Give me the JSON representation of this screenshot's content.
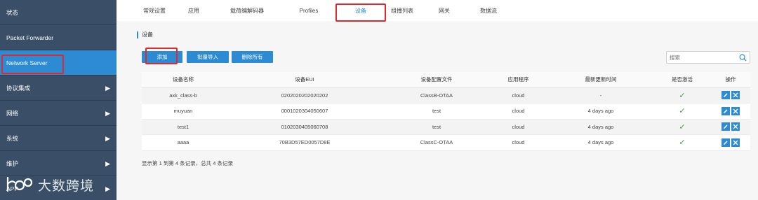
{
  "sidebar": {
    "items": [
      {
        "label": "状态",
        "has_arrow": false
      },
      {
        "label": "Packet Forwarder",
        "has_arrow": false
      },
      {
        "label": "Network Server",
        "has_arrow": false,
        "active": true
      },
      {
        "label": "协议集成",
        "has_arrow": true
      },
      {
        "label": "网络",
        "has_arrow": true
      },
      {
        "label": "系统",
        "has_arrow": true
      },
      {
        "label": "维护",
        "has_arrow": true
      },
      {
        "label": "APP",
        "has_arrow": true
      }
    ]
  },
  "watermark": {
    "text": "大数跨境"
  },
  "tabs": [
    {
      "label": "常规设置"
    },
    {
      "label": "应用"
    },
    {
      "label": "载荷编解码器"
    },
    {
      "label": "Profiles"
    },
    {
      "label": "设备",
      "active": true
    },
    {
      "label": "组播列表"
    },
    {
      "label": "网关"
    },
    {
      "label": "数据流"
    }
  ],
  "main": {
    "section_title": "设备",
    "buttons": {
      "add": "添加",
      "import": "批量导入",
      "delete_all": "删除所有"
    },
    "search": {
      "placeholder": "搜索"
    },
    "table": {
      "headers": [
        "设备名称",
        "设备EUI",
        "设备配置文件",
        "应用程序",
        "最新更新时间",
        "是否激活",
        "操作"
      ],
      "rows": [
        {
          "name": "axk_class-b",
          "eui": "0202020202020202",
          "profile": "ClassB-OTAA",
          "app": "cloud",
          "updated": "-",
          "active": true
        },
        {
          "name": "muyuan",
          "eui": "0001020304050607",
          "profile": "test",
          "app": "cloud",
          "updated": "4 days ago",
          "active": true
        },
        {
          "name": "test1",
          "eui": "0102030405060708",
          "profile": "test",
          "app": "cloud",
          "updated": "4 days ago",
          "active": true
        },
        {
          "name": "aaaa",
          "eui": "70B3D57ED0057D8E",
          "profile": "ClassC-OTAA",
          "app": "cloud",
          "updated": "4 days ago",
          "active": true
        }
      ]
    },
    "summary": "显示第 1 到第 4 条记录，总共 4 条记录"
  },
  "colors": {
    "sidebar_bg": "#3a4f67",
    "accent": "#2c8bd2",
    "highlight_box": "#e0292b",
    "check": "#3c9d3c"
  }
}
